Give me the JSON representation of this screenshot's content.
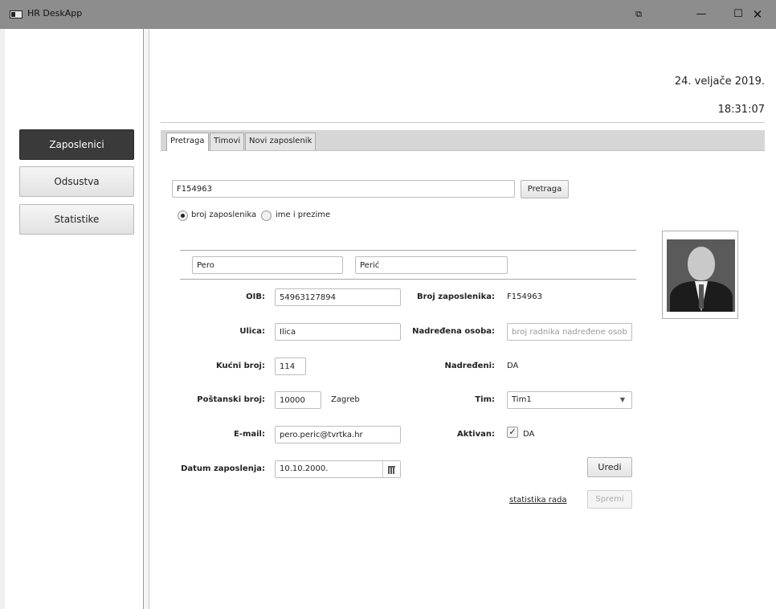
{
  "window": {
    "title": "HR DeskApp",
    "controls": {
      "minimize": "—",
      "maximize": "☐",
      "close": "✕"
    }
  },
  "sidebar": {
    "items": [
      {
        "label": "Zaposlenici",
        "active": true
      },
      {
        "label": "Odsustva",
        "active": false
      },
      {
        "label": "Statistike",
        "active": false
      }
    ]
  },
  "header": {
    "date": "24. veljače 2019.",
    "time": "18:31:07"
  },
  "tabs": [
    {
      "label": "Pretraga",
      "active": true
    },
    {
      "label": "Timovi",
      "active": false
    },
    {
      "label": "Novi zaposlenik",
      "active": false
    }
  ],
  "search": {
    "value": "F154963",
    "button_label": "Pretraga",
    "options": [
      {
        "label": "broj zaposlenika",
        "checked": true
      },
      {
        "label": "ime i prezime",
        "checked": false
      }
    ]
  },
  "employee": {
    "first_name": "Pero",
    "last_name": "Perić",
    "fields": {
      "oib": {
        "label": "OIB:",
        "value": "54963127894"
      },
      "ulica": {
        "label": "Ulica:",
        "value": "Ilica"
      },
      "kucni_broj": {
        "label": "Kućni broj:",
        "value": "114"
      },
      "postanski_broj": {
        "label": "Poštanski broj:",
        "value": "10000",
        "city": "Zagreb"
      },
      "email": {
        "label": "E-mail:",
        "value": "pero.peric@tvrtka.hr"
      },
      "datum": {
        "label": "Datum zaposlenja:",
        "value": "10.10.2000."
      },
      "broj_zaposlenika": {
        "label": "Broj zaposlenika:",
        "value": "F154963"
      },
      "nadredena_osoba": {
        "label": "Nadređena osoba:",
        "placeholder": "broj radnika nadređene osobe"
      },
      "nadredeni": {
        "label": "Nadređeni:",
        "value": "DA"
      },
      "tim": {
        "label": "Tim:",
        "value": "Tim1"
      },
      "aktivan": {
        "label": "Aktivan:",
        "value": "DA",
        "checked": true
      }
    }
  },
  "actions": {
    "edit_label": "Uredi",
    "stats_link": "statistika rada",
    "save_label": "Spremi"
  }
}
